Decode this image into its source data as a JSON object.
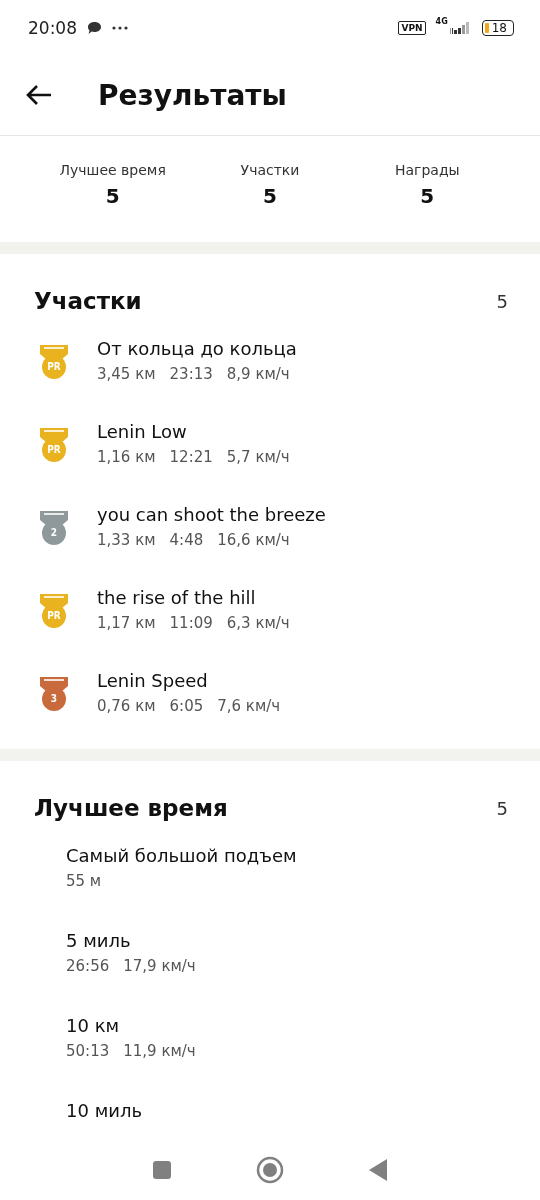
{
  "status_bar": {
    "time": "20:08",
    "vpn": "VPN",
    "network": "4G",
    "battery": "18"
  },
  "header": {
    "title": "Результаты"
  },
  "stats": [
    {
      "label": "Лучшее время",
      "value": "5"
    },
    {
      "label": "Участки",
      "value": "5"
    },
    {
      "label": "Награды",
      "value": "5"
    }
  ],
  "segments": {
    "title": "Участки",
    "count": "5",
    "items": [
      {
        "medal": "PR",
        "color": "#e9b21f",
        "name": "От кольца до кольца",
        "details": [
          "3,45 км",
          "23:13",
          "8,9 км/ч"
        ]
      },
      {
        "medal": "PR",
        "color": "#e9b21f",
        "name": "Lenin Low",
        "details": [
          "1,16 км",
          "12:21",
          "5,7 км/ч"
        ]
      },
      {
        "medal": "2",
        "color": "#8f999c",
        "name": "you can shoot the breeze",
        "details": [
          "1,33 км",
          "4:48",
          "16,6 км/ч"
        ]
      },
      {
        "medal": "PR",
        "color": "#e9b21f",
        "name": "the rise of the hill",
        "details": [
          "1,17 км",
          "11:09",
          "6,3 км/ч"
        ]
      },
      {
        "medal": "3",
        "color": "#c96a3c",
        "name": "Lenin Speed",
        "details": [
          "0,76 км",
          "6:05",
          "7,6 км/ч"
        ]
      }
    ]
  },
  "best_times": {
    "title": "Лучшее время",
    "count": "5",
    "items": [
      {
        "name": "Самый большой подъем",
        "details": [
          "55 м"
        ]
      },
      {
        "name": "5 миль",
        "details": [
          "26:56",
          "17,9 км/ч"
        ]
      },
      {
        "name": "10 км",
        "details": [
          "50:13",
          "11,9 км/ч"
        ]
      },
      {
        "name": "10 миль"
      }
    ]
  }
}
